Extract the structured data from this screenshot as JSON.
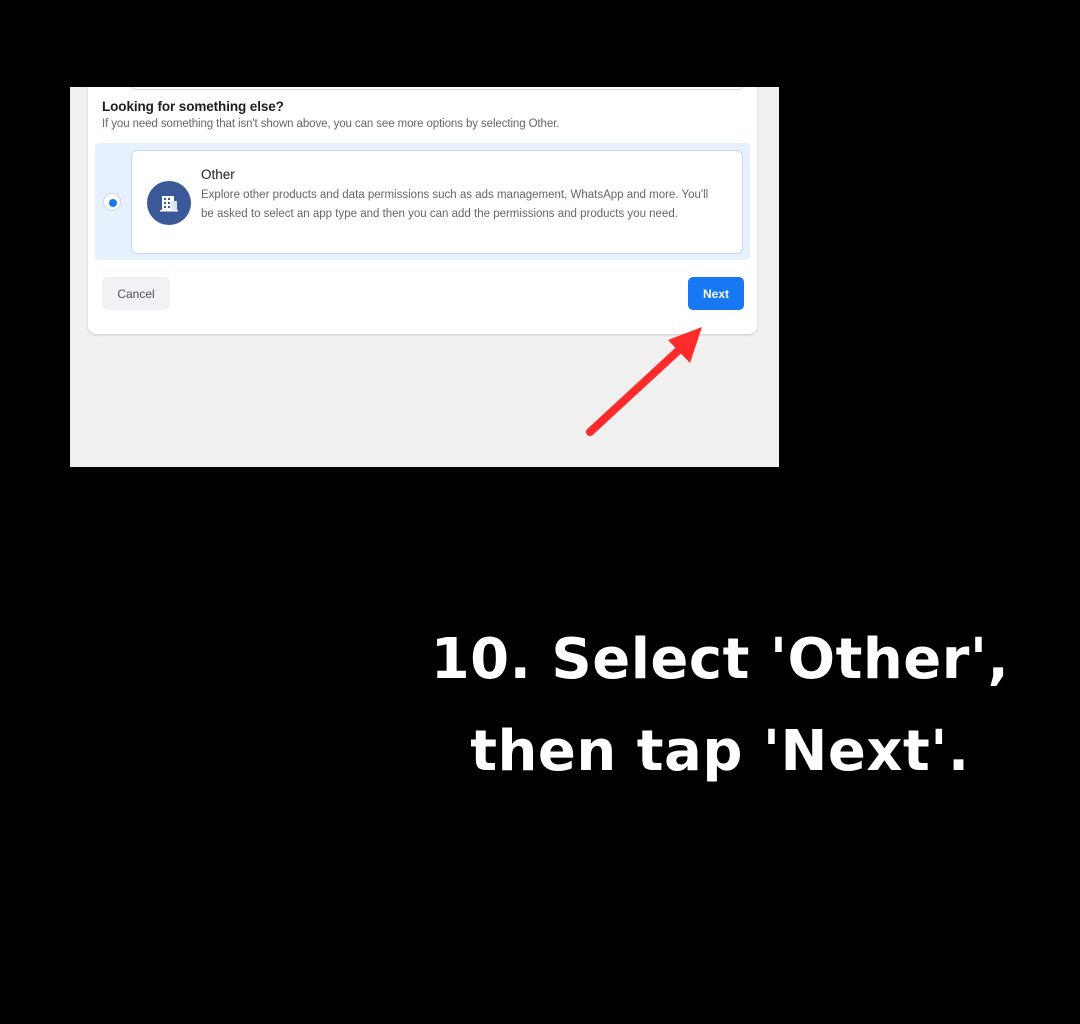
{
  "dialog": {
    "heading": "Looking for something else?",
    "subheading": "If you need something that isn't shown above, you can see more options by selecting Other.",
    "option": {
      "title": "Other",
      "description": "Explore other products and data permissions such as ads management, WhatsApp and more. You'll be asked to select an app type and then you can add the permissions and products you need.",
      "icon": "building-icon",
      "selected": true
    },
    "cancel_label": "Cancel",
    "next_label": "Next"
  },
  "annotation": {
    "arrow_color": "#ff2a2a",
    "arrow_target": "next-button"
  },
  "caption": {
    "line1": "10. Select 'Other',",
    "line2": "then tap 'Next'."
  },
  "colors": {
    "primary": "#1877f2",
    "selected_bg": "#e7f0fd",
    "icon_bg": "#3b5998"
  }
}
